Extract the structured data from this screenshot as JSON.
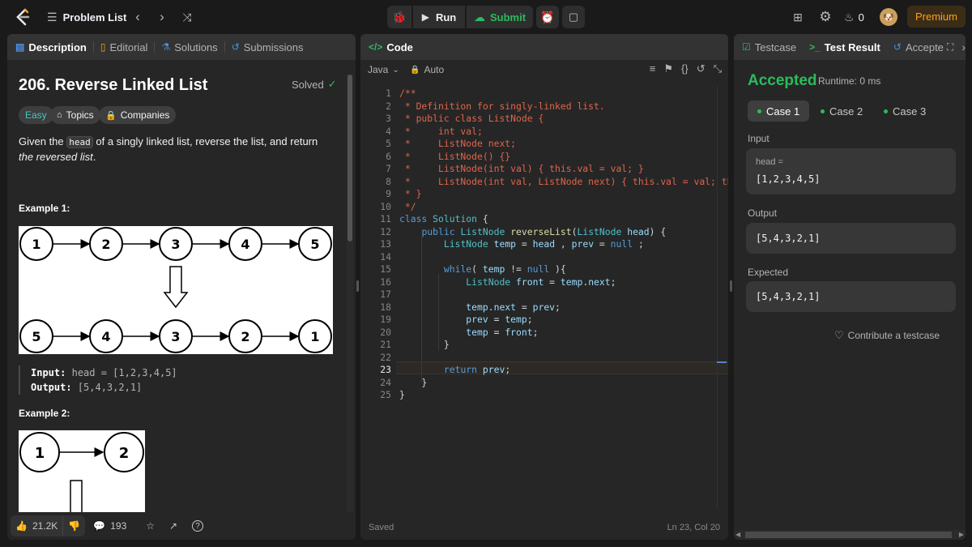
{
  "topbar": {
    "problem_list_label": "Problem List",
    "run_label": "Run",
    "submit_label": "Submit",
    "streak_count": "0",
    "premium_label": "Premium"
  },
  "description": {
    "tabs": [
      "Description",
      "Editorial",
      "Solutions",
      "Submissions"
    ],
    "title": "206. Reverse Linked List",
    "solved_label": "Solved",
    "difficulty": "Easy",
    "topics_label": "Topics",
    "companies_label": "Companies",
    "text_before": "Given the ",
    "text_code": "head",
    "text_mid": " of a singly linked list, reverse the list, and return ",
    "text_italic": "the reversed list",
    "text_end": ".",
    "example1_title": "Example 1:",
    "example1_top": [
      "1",
      "2",
      "3",
      "4",
      "5"
    ],
    "example1_bottom": [
      "5",
      "4",
      "3",
      "2",
      "1"
    ],
    "example1_input_label": "Input:",
    "example1_input_value": "head = [1,2,3,4,5]",
    "example1_output_label": "Output:",
    "example1_output_value": "[5,4,3,2,1]",
    "example2_title": "Example 2:",
    "example2_nodes": [
      "1",
      "2"
    ],
    "likes": "21.2K",
    "comments": "193"
  },
  "code": {
    "tab_label": "Code",
    "language": "Java",
    "mode": "Auto",
    "lines": [
      {
        "n": "1",
        "t": "/**"
      },
      {
        "n": "2",
        "t": " * Definition for singly-linked list."
      },
      {
        "n": "3",
        "t": " * public class ListNode {"
      },
      {
        "n": "4",
        "t": " *     int val;"
      },
      {
        "n": "5",
        "t": " *     ListNode next;"
      },
      {
        "n": "6",
        "t": " *     ListNode() {}"
      },
      {
        "n": "7",
        "t": " *     ListNode(int val) { this.val = val; }"
      },
      {
        "n": "8",
        "t": " *     ListNode(int val, ListNode next) { this.val = val; this.nex"
      },
      {
        "n": "9",
        "t": " * }"
      },
      {
        "n": "10",
        "t": " */"
      },
      {
        "n": "11",
        "t": "class Solution {"
      },
      {
        "n": "12",
        "t": "    public ListNode reverseList(ListNode head) {"
      },
      {
        "n": "13",
        "t": "        ListNode temp = head , prev = null ;"
      },
      {
        "n": "14",
        "t": ""
      },
      {
        "n": "15",
        "t": "        while( temp != null ){"
      },
      {
        "n": "16",
        "t": "            ListNode front = temp.next;"
      },
      {
        "n": "17",
        "t": ""
      },
      {
        "n": "18",
        "t": "            temp.next = prev;"
      },
      {
        "n": "19",
        "t": "            prev = temp;"
      },
      {
        "n": "20",
        "t": "            temp = front;"
      },
      {
        "n": "21",
        "t": "        }"
      },
      {
        "n": "22",
        "t": ""
      },
      {
        "n": "23",
        "t": "        return prev;"
      },
      {
        "n": "24",
        "t": "    }"
      },
      {
        "n": "25",
        "t": "}"
      }
    ],
    "status_saved": "Saved",
    "cursor_pos": "Ln 23, Col 20"
  },
  "result": {
    "tabs": [
      "Testcase",
      "Test Result",
      "Accepte"
    ],
    "status": "Accepted",
    "runtime": "Runtime: 0 ms",
    "cases": [
      "Case 1",
      "Case 2",
      "Case 3"
    ],
    "input_label": "Input",
    "input_var": "head =",
    "input_value": "[1,2,3,4,5]",
    "output_label": "Output",
    "output_value": "[5,4,3,2,1]",
    "expected_label": "Expected",
    "expected_value": "[5,4,3,2,1]",
    "contribute_label": "Contribute a testcase"
  },
  "colors": {
    "accepted": "#2cbb5d",
    "submit": "#2cbb5d",
    "premium": "#ffa116",
    "easy": "#46c6c2"
  }
}
